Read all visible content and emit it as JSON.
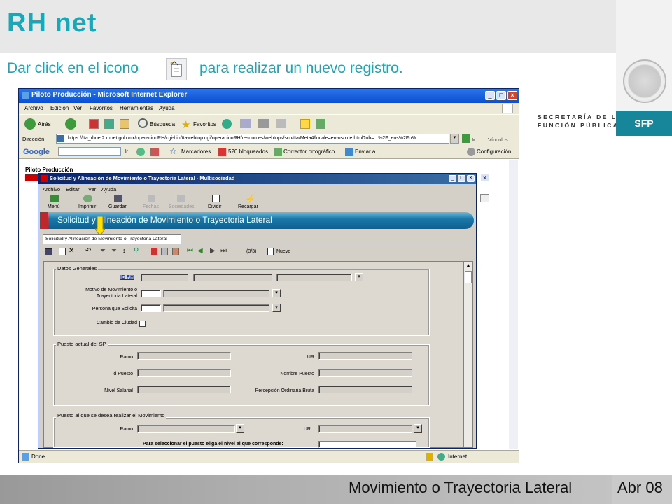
{
  "slide": {
    "title": "RH net",
    "instruction_pre": "Dar click en el icono",
    "instruction_post": "para realizar un nuevo registro.",
    "footer_text": "Movimiento o Trayectoria Lateral",
    "footer_date": "Abr 08",
    "logo": {
      "line1": "SECRETARÍA DE LA",
      "line2": "FUNCIÓN PÚBLICA",
      "abbr": "SFP",
      "seal_icon": "mexican-seal-icon"
    },
    "colors": {
      "title": "#1aa7b8",
      "sfp": "#17869a"
    }
  },
  "ie": {
    "title": "Piloto Producción - Microsoft Internet Explorer",
    "menu": [
      "Archivo",
      "Edición",
      "Ver",
      "Favoritos",
      "Herramientas",
      "Ayuda"
    ],
    "toolbar": {
      "back": "Atrás",
      "search": "Búsqueda",
      "favorites": "Favoritos"
    },
    "address_label": "Dirección",
    "address_url": "https://tta_rhnet2.rhnet.gob.mx/operacionRH/cgi-bin/ttawebtop.cgi/operacionRH/resources/webtops/sco/tta/Meta4/locale=en-us/xde.html?ob=...%2F_ens%2Fo%",
    "go": "Ir",
    "links": "Vínculos",
    "google_bar": {
      "go": "Ir",
      "bookmarks": "Marcadores",
      "blocked": "520 bloqueados",
      "spell": "Corrector ortográfico",
      "send": "Enviar a",
      "settings": "Configuración"
    },
    "page_heading": "Piloto Producción",
    "status_done": "Done",
    "status_zone": "Internet"
  },
  "app": {
    "title": "Solicitud y Alineación de Movimiento o Trayectoria Lateral - Multisociedad",
    "menu": [
      "Archivo",
      "Editar",
      "Ver",
      "Ayuda"
    ],
    "toolbar": [
      "Menú",
      "Imprimir",
      "Guardar",
      "Fechas",
      "Sociedades",
      "Dividir",
      "Recargar"
    ],
    "banner": "Solicitud y Alineación de Movimiento o Trayectoria Lateral",
    "tab": "Solicitud y Alineación de Movimiento o Trayectoria Lateral",
    "record_counter": "(3/3)",
    "new_button": "Nuevo",
    "datos_generales": {
      "legend": "Datos Generales",
      "id_rh": "ID RH",
      "motivo_1": "Motivo  de Movimiento o",
      "motivo_2": "Trayectoria Lateral",
      "persona": "Persona que Solicita",
      "cambio": "Cambio de Ciudad"
    },
    "puesto_actual": {
      "legend": "Puesto actual del SP",
      "ramo": "Ramo",
      "ur": "UR",
      "id_puesto": "Id Puesto",
      "nombre_puesto": "Nombre Puesto",
      "nivel": "Nivel Salarial",
      "percepcion": "Percepción Ordinaria Bruta"
    },
    "puesto_nuevo": {
      "legend": "Puesto al que se desea realizar el Movimiento",
      "ramo": "Ramo",
      "ur": "UR",
      "nivel_prompt": "Para seleccionar el puesto eliga el nivel al que corresponde:"
    }
  }
}
